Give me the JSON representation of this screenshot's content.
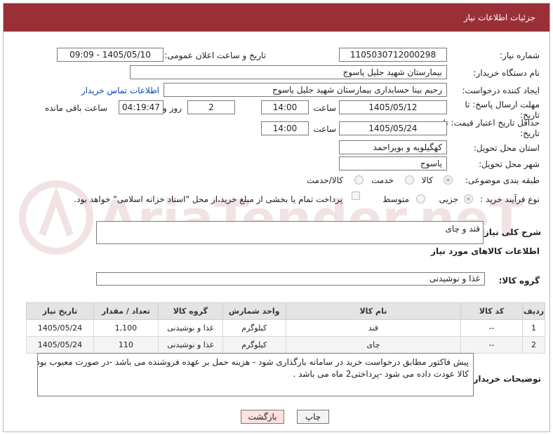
{
  "header": {
    "title": "جزئیات اطلاعات نیاز"
  },
  "fields": {
    "need_number_label": "شماره نیاز:",
    "need_number": "1105030712000298",
    "announce_label": "تاریخ و ساعت اعلان عمومی:",
    "announce_value": "1405/05/10 - 09:09",
    "buyer_label": "نام دستگاه خریدار:",
    "buyer_value": "بیمارستان شهید جلیل یاسوج",
    "creator_label": "ایجاد کننده درخواست:",
    "creator_value": "رحیم بینا حسابداری بیمارستان شهید جلیل یاسوج",
    "contact_link": "اطلاعات تماس خریدار",
    "deadline_label": "مهلت ارسال پاسخ: تا تاریخ:",
    "deadline_date": "1405/05/12",
    "time_label": "ساعت",
    "deadline_time": "14:00",
    "days_value": "2",
    "days_label": "روز و",
    "remaining_time": "04:19:47",
    "remaining_label": "ساعت باقی مانده",
    "price_label": "حداقل تاریخ اعتبار قیمت: تا تاریخ:",
    "price_date": "1405/05/24",
    "price_time": "14:00",
    "province_label": "استان محل تحویل:",
    "province_value": "کهگیلویه و بویراحمد",
    "city_label": "شهر محل تحویل:",
    "city_value": "یاسوج",
    "category_label": "طبقه بندی موضوعی:",
    "cat_goods": "کالا",
    "cat_service": "خدمت",
    "cat_both": "کالا/خدمت",
    "process_label": "نوع فرآیند خرید :",
    "proc_partial": "جزیی",
    "proc_medium": "متوسط",
    "payment_note": "پرداخت تمام یا بخشی از مبلغ خرید،از محل \"اسناد خزانه اسلامی\" خواهد بود.",
    "description_label": "شرح کلی نیاز:",
    "description_value": "قند و چای",
    "goods_info_title": "اطلاعات کالاهای مورد نیاز",
    "goods_group_label": "گروه کالا:",
    "goods_group_value": "غذا و نوشیدنی"
  },
  "table": {
    "headers": [
      "ردیف",
      "کد کالا",
      "نام کالا",
      "واحد شمارش",
      "گروه کالا",
      "تعداد / مقدار",
      "تاریخ نیاز"
    ],
    "rows": [
      [
        "1",
        "--",
        "قند",
        "کیلوگرم",
        "غذا و نوشیدنی",
        "1,100",
        "1405/05/24"
      ],
      [
        "2",
        "--",
        "چای",
        "کیلوگرم",
        "غذا و نوشیدنی",
        "110",
        "1405/05/24"
      ]
    ]
  },
  "notes": {
    "label": "توضیحات خریدار:",
    "line1": "پیش فاکتور مطابق درخواست خرید در سامانه بارگذاری شود - هزینه حمل بر عهده فروشنده می باشد -در صورت معیوب بودن",
    "line2": "کالا عودت داده می شود -پرداختی2 ماه می باشد ."
  },
  "buttons": {
    "print": "چاپ",
    "back": "بازگشت"
  },
  "watermark": {
    "text": "AriaTender.neT"
  },
  "colors": {
    "header_bg": "#9a2f37",
    "link": "#0645ad",
    "back_button_bg": "#fde0e0"
  }
}
